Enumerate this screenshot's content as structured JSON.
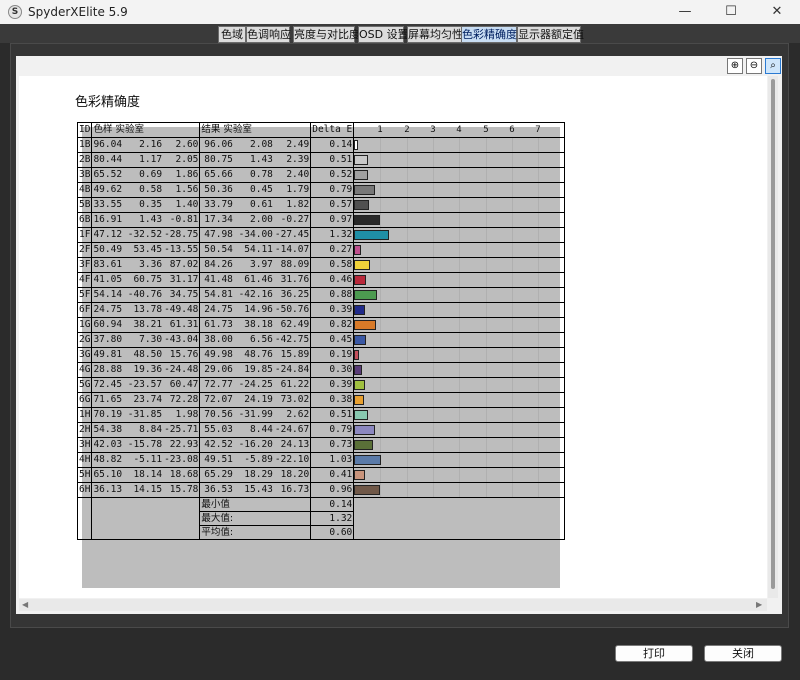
{
  "window": {
    "title": "SpyderXElite 5.9",
    "app_icon_glyph": "S",
    "minimize_glyph": "—",
    "maximize_glyph": "☐",
    "close_glyph": "✕"
  },
  "tabs": [
    {
      "label": "色域",
      "active": false
    },
    {
      "label": "色调响应",
      "active": false
    },
    {
      "label": "亮度与对比度",
      "active": false
    },
    {
      "label": "OSD 设置",
      "active": false
    },
    {
      "label": "屏幕均匀性",
      "active": false
    },
    {
      "label": "色彩精确度",
      "active": true
    },
    {
      "label": "显示器额定值",
      "active": false
    }
  ],
  "toolbar": {
    "zoom_in_icon": "zoom-in-icon",
    "zoom_out_icon": "zoom-out-icon",
    "zoom_fit_icon": "zoom-fit-icon",
    "zoom_in_glyph": "⊕",
    "zoom_out_glyph": "⊖",
    "zoom_fit_glyph": "⌕"
  },
  "report": {
    "title": "色彩精确度",
    "headers": {
      "id": "ID",
      "sample": "色样 实验室",
      "result": "结果 实验室",
      "delta": "Delta E"
    },
    "scale": [
      "1",
      "2",
      "3",
      "4",
      "5",
      "6",
      "7"
    ],
    "rows": [
      {
        "id": "1B",
        "s": [
          "96.04",
          "2.16",
          "2.60"
        ],
        "r": [
          "96.06",
          "2.08",
          "2.49"
        ],
        "de": "0.14",
        "color": "#ffffff"
      },
      {
        "id": "2B",
        "s": [
          "80.44",
          "1.17",
          "2.05"
        ],
        "r": [
          "80.75",
          "1.43",
          "2.39"
        ],
        "de": "0.51",
        "color": "#c8c8c8"
      },
      {
        "id": "3B",
        "s": [
          "65.52",
          "0.69",
          "1.86"
        ],
        "r": [
          "65.66",
          "0.78",
          "2.40"
        ],
        "de": "0.52",
        "color": "#a0a0a0"
      },
      {
        "id": "4B",
        "s": [
          "49.62",
          "0.58",
          "1.56"
        ],
        "r": [
          "50.36",
          "0.45",
          "1.79"
        ],
        "de": "0.79",
        "color": "#787878"
      },
      {
        "id": "5B",
        "s": [
          "33.55",
          "0.35",
          "1.40"
        ],
        "r": [
          "33.79",
          "0.61",
          "1.82"
        ],
        "de": "0.57",
        "color": "#505050"
      },
      {
        "id": "6B",
        "s": [
          "16.91",
          "1.43",
          "-0.81"
        ],
        "r": [
          "17.34",
          "2.00",
          "-0.27"
        ],
        "de": "0.97",
        "color": "#282828"
      },
      {
        "id": "1F",
        "s": [
          "47.12",
          "-32.52",
          "-28.75"
        ],
        "r": [
          "47.98",
          "-34.00",
          "-27.45"
        ],
        "de": "1.32",
        "color": "#1f8fa6"
      },
      {
        "id": "2F",
        "s": [
          "50.49",
          "53.45",
          "-13.55"
        ],
        "r": [
          "50.54",
          "54.11",
          "-14.07"
        ],
        "de": "0.27",
        "color": "#c0508e"
      },
      {
        "id": "3F",
        "s": [
          "83.61",
          "3.36",
          "87.02"
        ],
        "r": [
          "84.26",
          "3.97",
          "88.09"
        ],
        "de": "0.58",
        "color": "#f0d23a"
      },
      {
        "id": "4F",
        "s": [
          "41.05",
          "60.75",
          "31.17"
        ],
        "r": [
          "41.48",
          "61.46",
          "31.76"
        ],
        "de": "0.46",
        "color": "#b8283a"
      },
      {
        "id": "5F",
        "s": [
          "54.14",
          "-40.76",
          "34.75"
        ],
        "r": [
          "54.81",
          "-42.16",
          "36.25"
        ],
        "de": "0.88",
        "color": "#4c9a50"
      },
      {
        "id": "6F",
        "s": [
          "24.75",
          "13.78",
          "-49.48"
        ],
        "r": [
          "24.75",
          "14.96",
          "-50.76"
        ],
        "de": "0.39",
        "color": "#202a8a"
      },
      {
        "id": "1G",
        "s": [
          "60.94",
          "38.21",
          "61.31"
        ],
        "r": [
          "61.73",
          "38.18",
          "62.49"
        ],
        "de": "0.82",
        "color": "#d87a28"
      },
      {
        "id": "2G",
        "s": [
          "37.80",
          "7.30",
          "-43.04"
        ],
        "r": [
          "38.00",
          "6.56",
          "-42.75"
        ],
        "de": "0.45",
        "color": "#3a58a4"
      },
      {
        "id": "3G",
        "s": [
          "49.81",
          "48.50",
          "15.76"
        ],
        "r": [
          "49.98",
          "48.76",
          "15.89"
        ],
        "de": "0.19",
        "color": "#c4505c"
      },
      {
        "id": "4G",
        "s": [
          "28.88",
          "19.36",
          "-24.48"
        ],
        "r": [
          "29.06",
          "19.85",
          "-24.84"
        ],
        "de": "0.30",
        "color": "#5a3c78"
      },
      {
        "id": "5G",
        "s": [
          "72.45",
          "-23.57",
          "60.47"
        ],
        "r": [
          "72.77",
          "-24.25",
          "61.22"
        ],
        "de": "0.39",
        "color": "#a0c040"
      },
      {
        "id": "6G",
        "s": [
          "71.65",
          "23.74",
          "72.28"
        ],
        "r": [
          "72.07",
          "24.19",
          "73.02"
        ],
        "de": "0.38",
        "color": "#e8a030"
      },
      {
        "id": "1H",
        "s": [
          "70.19",
          "-31.85",
          "1.98"
        ],
        "r": [
          "70.56",
          "-31.99",
          "2.62"
        ],
        "de": "0.51",
        "color": "#88c8b0"
      },
      {
        "id": "2H",
        "s": [
          "54.38",
          "8.84",
          "-25.71"
        ],
        "r": [
          "55.03",
          "8.44",
          "-24.67"
        ],
        "de": "0.79",
        "color": "#8c88c0"
      },
      {
        "id": "3H",
        "s": [
          "42.03",
          "-15.78",
          "22.93"
        ],
        "r": [
          "42.52",
          "-16.20",
          "24.13"
        ],
        "de": "0.73",
        "color": "#5a7038"
      },
      {
        "id": "4H",
        "s": [
          "48.82",
          "-5.11",
          "-23.08"
        ],
        "r": [
          "49.51",
          "-5.89",
          "-22.10"
        ],
        "de": "1.03",
        "color": "#5a7aa8"
      },
      {
        "id": "5H",
        "s": [
          "65.10",
          "18.14",
          "18.68"
        ],
        "r": [
          "65.29",
          "18.29",
          "18.20"
        ],
        "de": "0.41",
        "color": "#c8947c"
      },
      {
        "id": "6H",
        "s": [
          "36.13",
          "14.15",
          "15.78"
        ],
        "r": [
          "36.53",
          "15.43",
          "16.73"
        ],
        "de": "0.96",
        "color": "#705848"
      }
    ],
    "summary": [
      {
        "label": "最小值",
        "value": "0.14"
      },
      {
        "label": "最大值:",
        "value": "1.32"
      },
      {
        "label": "平均值:",
        "value": "0.60"
      }
    ]
  },
  "buttons": {
    "print": "打印",
    "close": "关闭"
  }
}
